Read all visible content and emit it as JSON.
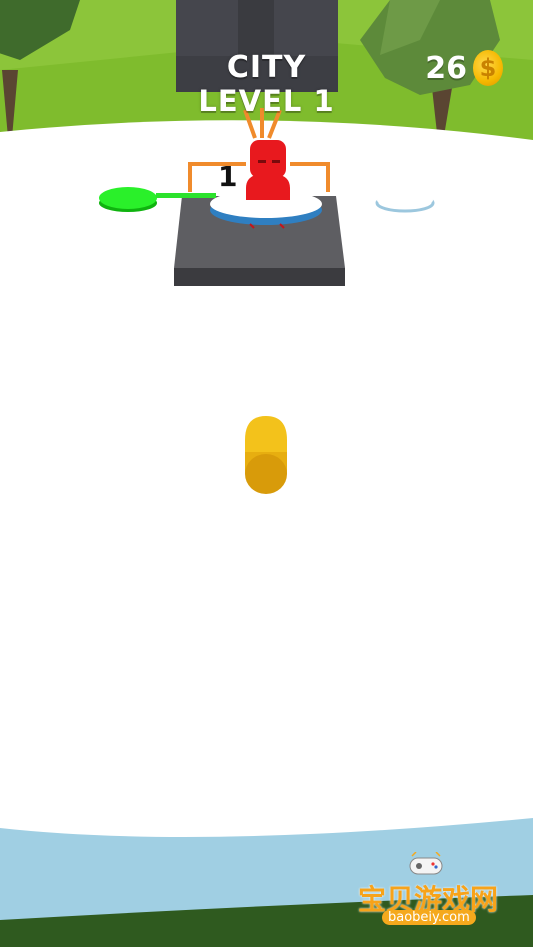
{
  "hud": {
    "world": "CITY",
    "level": "LEVEL 1",
    "coins": "26",
    "coin_symbol": "$"
  },
  "scene": {
    "enemy_count": "1",
    "colors": {
      "sky_grass": "#7fbc2d",
      "ground": "#ffffff",
      "water": "#9fcde1",
      "enemy": "#e8191e",
      "bullet": "#f0b400",
      "switch": "#1fe01f",
      "platform": "#5e5e62",
      "wire": "#f08b2c"
    },
    "icons": [
      "coin-icon",
      "enemy-figure",
      "bullet-projectile",
      "green-switch-pad",
      "tree"
    ]
  },
  "watermark": {
    "title": "宝贝游戏网",
    "url": "baobeiy.com"
  }
}
